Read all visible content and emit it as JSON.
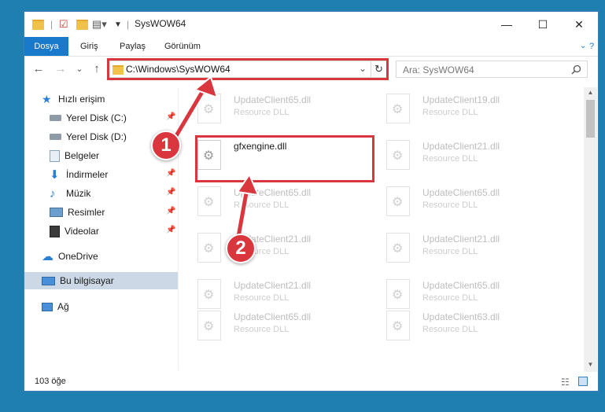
{
  "window": {
    "title": "SysWOW64",
    "controls": {
      "minimize": "—",
      "maximize": "☐",
      "close": "✕"
    }
  },
  "ribbon": {
    "tabs": [
      "Dosya",
      "Giriş",
      "Paylaş",
      "Görünüm"
    ],
    "active": "Dosya"
  },
  "navigation": {
    "back": "←",
    "forward": "→",
    "dropdown": "⌄",
    "up": "↑",
    "address": "C:\\Windows\\SysWOW64",
    "refresh": "↻",
    "search_placeholder": "Ara: SysWOW64"
  },
  "sidebar": {
    "quick_access": "Hızlı erişim",
    "items": [
      "Yerel Disk (C:)",
      "Yerel Disk (D:)",
      "Belgeler",
      "İndirmeler",
      "Müzik",
      "Resimler",
      "Videolar"
    ],
    "onedrive": "OneDrive",
    "this_pc": "Bu bilgisayar",
    "network": "Ağ"
  },
  "files": [
    {
      "name": "UpdateClient65.dll",
      "type": "Resource DLL"
    },
    {
      "name": "UpdateClient19.dll",
      "type": "Resource DLL"
    },
    {
      "name": "gfxengine.dll",
      "type": ""
    },
    {
      "name": "UpdateClient21.dll",
      "type": "Resource DLL"
    },
    {
      "name": "UpdateClient65.dll",
      "type": "Resource DLL"
    },
    {
      "name": "UpdateClient65.dll",
      "type": "Resource DLL"
    },
    {
      "name": "UpdateClient21.dll",
      "type": "Resource DLL"
    },
    {
      "name": "UpdateClient21.dll",
      "type": "Resource DLL"
    },
    {
      "name": "UpdateClient21.dll",
      "type": "Resource DLL"
    },
    {
      "name": "UpdateClient65.dll",
      "type": "Resource DLL"
    },
    {
      "name": "UpdateClient65.dll",
      "type": "Resource DLL"
    },
    {
      "name": "UpdateClient63.dll",
      "type": "Resource DLL"
    }
  ],
  "status": {
    "item_count": "103 öğe"
  },
  "annotations": {
    "step1": "1",
    "step2": "2",
    "color": "#d9363e"
  }
}
